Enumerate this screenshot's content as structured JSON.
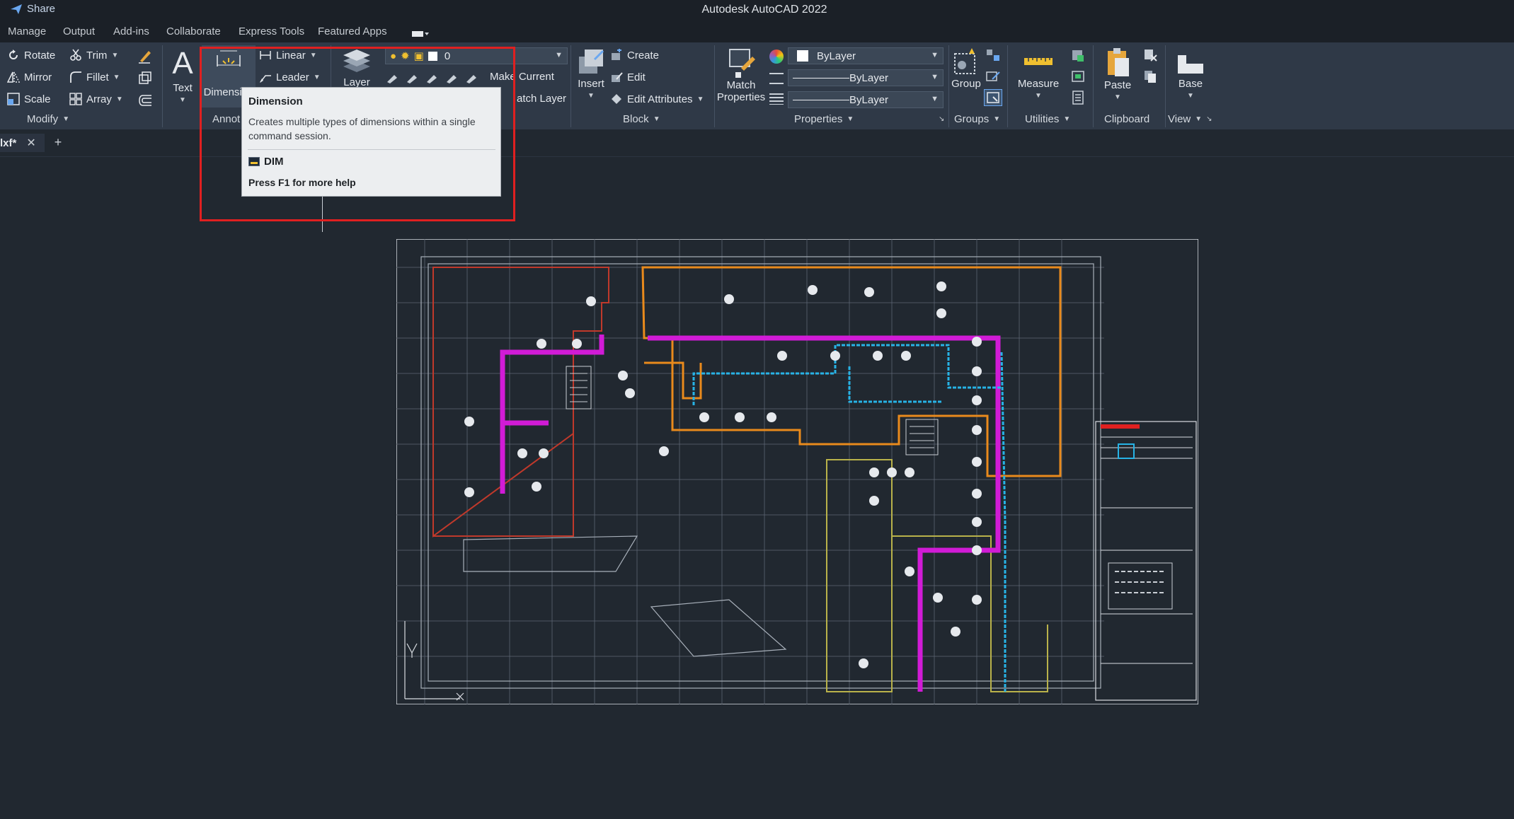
{
  "titlebar": {
    "share_label": "Share",
    "app_title": "Autodesk AutoCAD 2022"
  },
  "menu_tabs": [
    "Manage",
    "Output",
    "Add-ins",
    "Collaborate",
    "Express Tools",
    "Featured Apps"
  ],
  "ribbon": {
    "modify": {
      "rotate": "Rotate",
      "trim": "Trim",
      "mirror": "Mirror",
      "fillet": "Fillet",
      "scale": "Scale",
      "array": "Array",
      "title": "Modify"
    },
    "annotation": {
      "text": "Text",
      "dimension": "Dimension",
      "linear": "Linear",
      "leader": "Leader",
      "title": "Annot"
    },
    "layers": {
      "layer": "Layer",
      "current_layer": "0",
      "make_current": "Make Current",
      "match_layer": "atch Layer"
    },
    "block": {
      "insert": "Insert",
      "create": "Create",
      "edit": "Edit",
      "edit_attributes": "Edit Attributes",
      "title": "Block"
    },
    "properties": {
      "match_properties_line1": "Match",
      "match_properties_line2": "Properties",
      "color": "ByLayer",
      "linetype": "ByLayer",
      "lineweight": "ByLayer",
      "title": "Properties"
    },
    "groups": {
      "group": "Group",
      "title": "Groups"
    },
    "utilities": {
      "measure": "Measure",
      "title": "Utilities"
    },
    "clipboard": {
      "paste": "Paste",
      "title": "Clipboard"
    },
    "view": {
      "base": "Base",
      "title": "View"
    }
  },
  "doc_tab": {
    "name": "lxf*"
  },
  "tooltip": {
    "title": "Dimension",
    "description": "Creates multiple types of dimensions within a single command session.",
    "command": "DIM",
    "help": "Press F1 for more help"
  },
  "colors": {
    "accent_red": "#e02020",
    "ribbon_bg": "#2f3947",
    "canvas_bg": "#212830",
    "magenta": "#d11bd6",
    "orange": "#e98a1c",
    "cyan": "#27b3e6"
  }
}
